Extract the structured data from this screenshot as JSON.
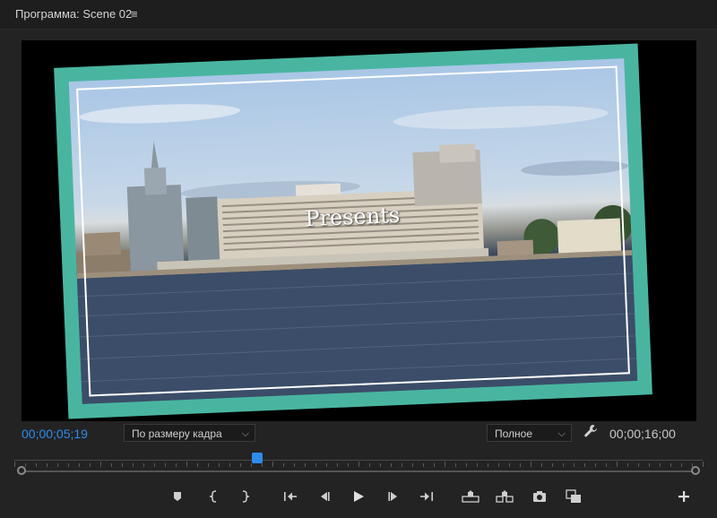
{
  "header": {
    "title": "Программа: Scene 02",
    "menu_glyph": "≡"
  },
  "viewer": {
    "overlay_text": "Presents"
  },
  "controls": {
    "current_timecode": "00;00;05;19",
    "duration_timecode": "00;00;16;00",
    "zoom_select": "По размеру кадра",
    "quality_select": "Полное",
    "playhead_position": 0.35
  },
  "transport_buttons": [
    {
      "name": "add-marker-button",
      "icon": "marker-icon"
    },
    {
      "name": "mark-in-button",
      "icon": "mark-in-icon"
    },
    {
      "name": "mark-out-button",
      "icon": "mark-out-icon"
    },
    {
      "name": "go-to-in-button",
      "icon": "go-to-in-icon"
    },
    {
      "name": "step-back-button",
      "icon": "step-back-icon"
    },
    {
      "name": "play-button",
      "icon": "play-icon"
    },
    {
      "name": "step-forward-button",
      "icon": "step-forward-icon"
    },
    {
      "name": "go-to-out-button",
      "icon": "go-to-out-icon"
    },
    {
      "name": "lift-button",
      "icon": "lift-icon"
    },
    {
      "name": "extract-button",
      "icon": "extract-icon"
    },
    {
      "name": "export-frame-button",
      "icon": "camera-icon"
    },
    {
      "name": "comparison-view-button",
      "icon": "comparison-icon"
    },
    {
      "name": "add-button",
      "icon": "plus-icon"
    }
  ],
  "colors": {
    "accent": "#2d8ceb",
    "frame_teal": "#49b5a0",
    "panel_bg": "#232323"
  }
}
